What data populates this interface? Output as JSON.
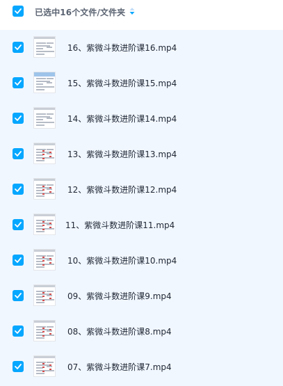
{
  "header": {
    "selected_label": "已选中16个文件/文件夹",
    "sort_icon": "sort-arrows-icon",
    "checkbox_checked": true
  },
  "colors": {
    "accent": "#06a7ff",
    "list_bg": "#f1f7ff"
  },
  "files": [
    {
      "name": "16、紫微斗数进阶课16.mp4",
      "checked": true,
      "thumb_icon": "video-thumbnail-icon"
    },
    {
      "name": "15、紫微斗数进阶课15.mp4",
      "checked": true,
      "thumb_icon": "video-thumbnail-icon"
    },
    {
      "name": "14、紫微斗数进阶课14.mp4",
      "checked": true,
      "thumb_icon": "video-thumbnail-icon"
    },
    {
      "name": "13、紫微斗数进阶课13.mp4",
      "checked": true,
      "thumb_icon": "video-thumbnail-icon"
    },
    {
      "name": "12、紫微斗数进阶课12.mp4",
      "checked": true,
      "thumb_icon": "video-thumbnail-icon"
    },
    {
      "name": "11、紫微斗数进阶课11.mp4",
      "checked": true,
      "thumb_icon": "video-thumbnail-icon"
    },
    {
      "name": "10、紫微斗数进阶课10.mp4",
      "checked": true,
      "thumb_icon": "video-thumbnail-icon"
    },
    {
      "name": "09、紫微斗数进阶课9.mp4",
      "checked": true,
      "thumb_icon": "video-thumbnail-icon"
    },
    {
      "name": "08、紫微斗数进阶课8.mp4",
      "checked": true,
      "thumb_icon": "video-thumbnail-icon"
    },
    {
      "name": "07、紫微斗数进阶课7.mp4",
      "checked": true,
      "thumb_icon": "video-thumbnail-icon"
    }
  ]
}
